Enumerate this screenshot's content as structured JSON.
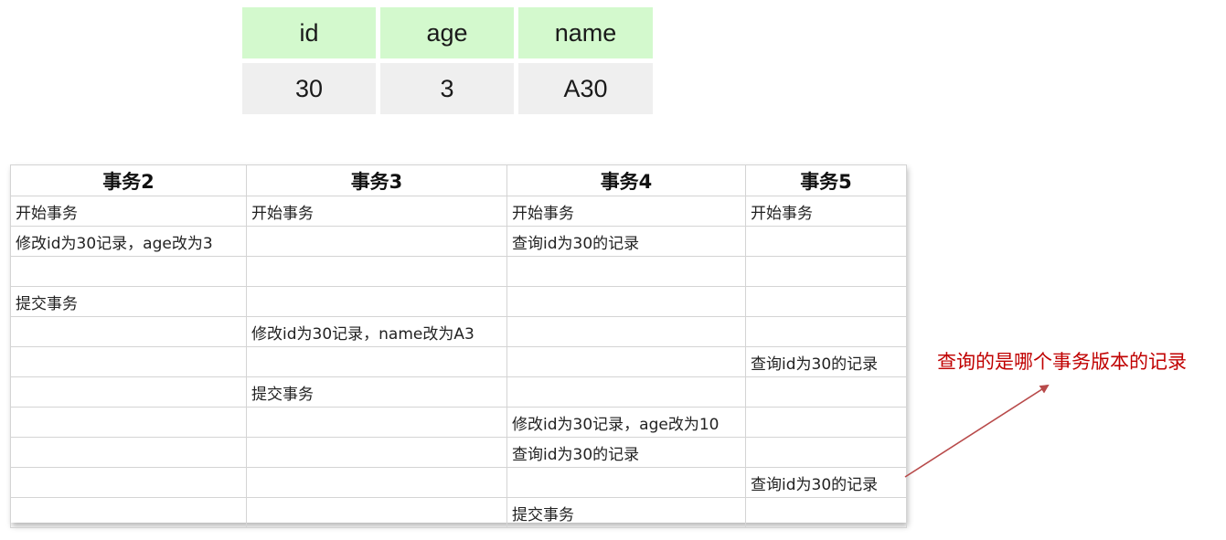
{
  "record_table": {
    "headers": [
      "id",
      "age",
      "name"
    ],
    "values": [
      "30",
      "3",
      "A30"
    ],
    "colors": {
      "header_bg": "#d3f9cd",
      "value_bg": "#efefef"
    }
  },
  "tx_table": {
    "headers": [
      "事务2",
      "事务3",
      "事务4",
      "事务5"
    ],
    "rows": [
      [
        "开始事务",
        "开始事务",
        "开始事务",
        "开始事务"
      ],
      [
        "修改id为30记录，age改为3",
        "",
        "查询id为30的记录",
        ""
      ],
      [
        "",
        "",
        "",
        ""
      ],
      [
        "提交事务",
        "",
        "",
        ""
      ],
      [
        "",
        "修改id为30记录，name改为A3",
        "",
        ""
      ],
      [
        "",
        "",
        "",
        "查询id为30的记录"
      ],
      [
        "",
        "提交事务",
        "",
        ""
      ],
      [
        "",
        "",
        "修改id为30记录，age改为10",
        ""
      ],
      [
        "",
        "",
        "查询id为30的记录",
        ""
      ],
      [
        "",
        "",
        "",
        "查询id为30的记录"
      ],
      [
        "",
        "",
        "提交事务",
        ""
      ]
    ]
  },
  "annotation": {
    "text": "查询的是哪个事务版本的记录",
    "color": "#c00000",
    "arrow_color": "#b84a4a"
  }
}
